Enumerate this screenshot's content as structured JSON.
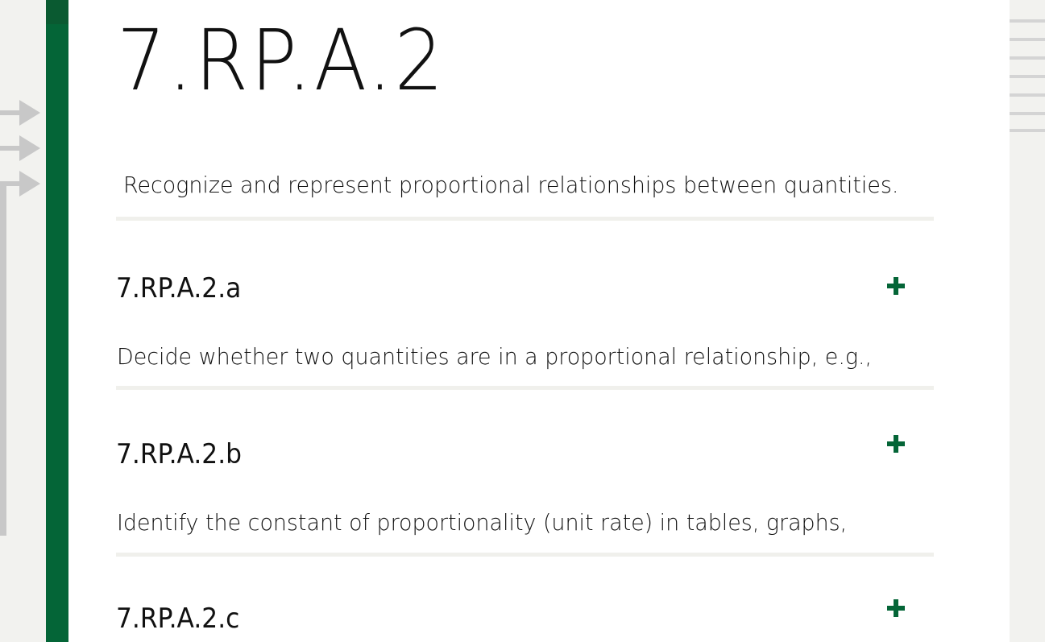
{
  "standard": {
    "code": "7.RP.A.2",
    "description": "Recognize and represent proportional relationships between quantities."
  },
  "sub_standards": [
    {
      "code": "7.RP.A.2.a",
      "text": "Decide whether two quantities are in a proportional relationship, e.g.,"
    },
    {
      "code": "7.RP.A.2.b",
      "text": "Identify the constant of proportionality (unit rate) in tables, graphs,"
    },
    {
      "code": "7.RP.A.2.c",
      "text": ""
    }
  ],
  "icons": {
    "expand": "plus-icon",
    "connector": "arrow-right-icon",
    "menu": "menu-lines-icon"
  },
  "colors": {
    "accent": "#046537",
    "plus": "#046537",
    "arrow": "#c8c8c8",
    "divider": "#f0f0ec",
    "background": "#f2f2ef"
  }
}
